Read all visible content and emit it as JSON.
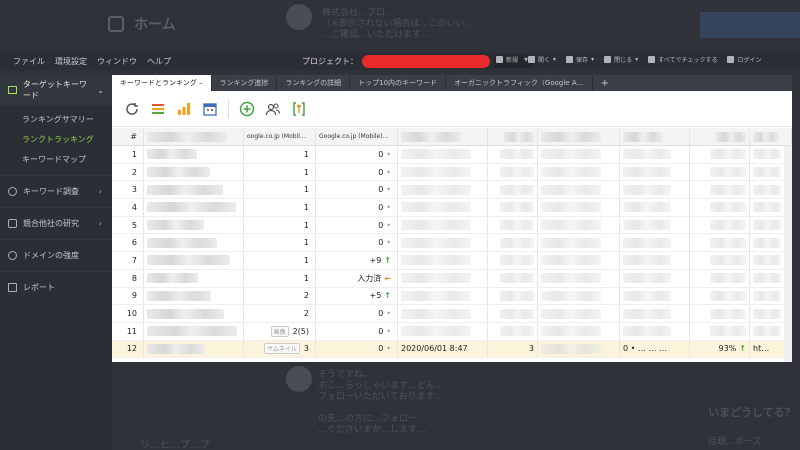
{
  "background_page": {
    "title": "ホーム",
    "post1_lines": [
      "株式会社…プロ…",
      "（※表示されない場合は…このいい…",
      "…ご確認…いただけます…"
    ],
    "post2_lines": [
      "そうですね。",
      "ホこ…らっしゃいます…どん…",
      "フォローいただいております…",
      "",
      "の先…の方に…フォロー",
      "…ぐださいまか…します…"
    ],
    "right_heading": "いまどうしてる？",
    "right_sub": "話題…ポーズ",
    "left_bottom": "リ…ヒ…プ…プ"
  },
  "menubar": {
    "items": [
      "ファイル",
      "環境設定",
      "ウィンドウ",
      "ヘルプ"
    ],
    "project_label": "プロジェクト：",
    "toolbar": [
      "新規",
      "開く",
      "保存",
      "閉じる",
      "すべてでチェックする",
      "ログイン"
    ]
  },
  "sidebar": {
    "top_label": "ターゲットキーワード",
    "sub_items": [
      "ランキングサマリー",
      "ランクトラッキング",
      "キーワードマップ"
    ],
    "sections": [
      "キーワード調査",
      "競合他社の研究",
      "ドメインの強度",
      "レポート"
    ]
  },
  "tabs": [
    "キーワードとランキング",
    "ランキング進捗",
    "ランキングの詳細",
    "トップ10内のキーワード",
    "オーガニックトラフィック（Google A…"
  ],
  "grid": {
    "headers": [
      "#",
      "",
      "oogle.co.jp (Mobil…",
      "Google.co.jp (Mobile)…"
    ],
    "rows": [
      {
        "n": "1",
        "rank": "1",
        "change": "0",
        "mark": "•"
      },
      {
        "n": "2",
        "rank": "1",
        "change": "0",
        "mark": "•"
      },
      {
        "n": "3",
        "rank": "1",
        "change": "0",
        "mark": "•"
      },
      {
        "n": "4",
        "rank": "1",
        "change": "0",
        "mark": "•"
      },
      {
        "n": "5",
        "rank": "1",
        "change": "0",
        "mark": "•"
      },
      {
        "n": "6",
        "rank": "1",
        "change": "0",
        "mark": "•"
      },
      {
        "n": "7",
        "rank": "1",
        "change": "+9",
        "mark": "↑"
      },
      {
        "n": "8",
        "rank": "1",
        "change": "入力済",
        "mark": "←"
      },
      {
        "n": "9",
        "rank": "2",
        "change": "+5",
        "mark": "↑"
      },
      {
        "n": "10",
        "rank": "2",
        "change": "0",
        "mark": "•"
      },
      {
        "n": "11",
        "rank": "2(5)",
        "change": "0",
        "mark": "•",
        "badge": "画像"
      },
      {
        "n": "12",
        "rank": "3",
        "change": "0",
        "mark": "•",
        "badge": "サムネイル",
        "date": "2020/06/01 8:47",
        "a": "3",
        "c": "0 • … …  …",
        "d": "93%",
        "e": "ht…"
      }
    ]
  }
}
